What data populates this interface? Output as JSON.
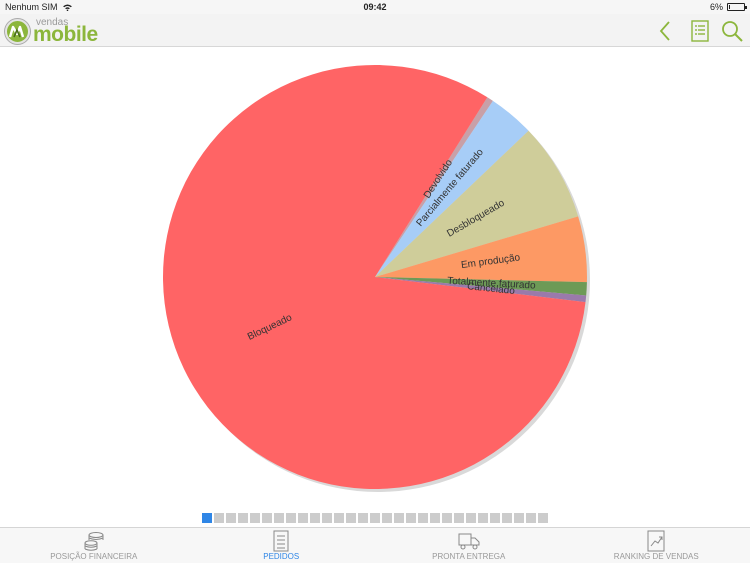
{
  "status_bar": {
    "carrier": "Nenhum SIM",
    "time": "09:42",
    "battery": "6%"
  },
  "header": {
    "logo_small": "vendas",
    "logo_big": "mobile",
    "logo_color": "#8cb63c"
  },
  "chart_data": {
    "type": "pie",
    "slices": [
      {
        "label": "Devolvido",
        "value": 0.5,
        "color": "#c8a0a8"
      },
      {
        "label": "Parcialmente faturado",
        "value": 3.5,
        "color": "#a7cdf7"
      },
      {
        "label": "Desbloqueado",
        "value": 7.5,
        "color": "#cfcd9a"
      },
      {
        "label": "Em produção",
        "value": 5.0,
        "color": "#fd9964"
      },
      {
        "label": "Totalmente faturado",
        "value": 1.0,
        "color": "#6d9a56"
      },
      {
        "label": "Cancelado",
        "value": 0.5,
        "color": "#9a7aab"
      },
      {
        "label": "Bloqueado",
        "value": 82.0,
        "color": "#ff6465"
      }
    ]
  },
  "pager": {
    "count": 29,
    "active_index": 0
  },
  "tabs": [
    {
      "label": "POSIÇÃO FINANCEIRA",
      "icon": "coins-icon",
      "active": false
    },
    {
      "label": "PEDIDOS",
      "icon": "document-list-icon",
      "active": true
    },
    {
      "label": "PRONTA ENTREGA",
      "icon": "truck-icon",
      "active": false
    },
    {
      "label": "RANKING DE VENDAS",
      "icon": "chart-document-icon",
      "active": false
    }
  ],
  "colors": {
    "accent": "#2f86e6",
    "tab_inactive": "#999999"
  }
}
